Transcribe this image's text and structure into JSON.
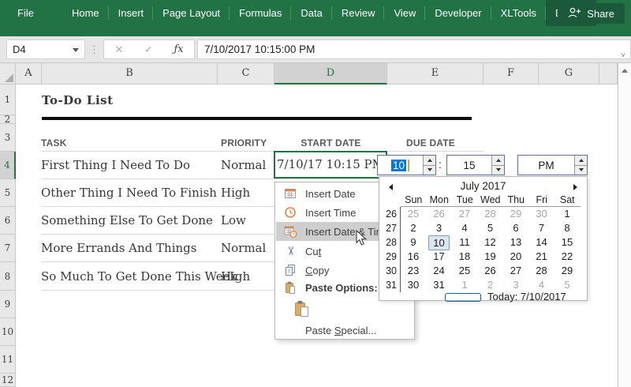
{
  "ribbon": {
    "tabs": [
      {
        "label": "File",
        "file_tab": true
      },
      {
        "label": "Home"
      },
      {
        "label": "Insert"
      },
      {
        "label": "Page Layout"
      },
      {
        "label": "Formulas"
      },
      {
        "label": "Data"
      },
      {
        "label": "Review"
      },
      {
        "label": "View"
      },
      {
        "label": "Developer"
      },
      {
        "label": "XLTools"
      },
      {
        "label": "Design",
        "active": true
      }
    ],
    "share_label": "Share",
    "colors": {
      "ribbon_green": "#217346",
      "active_tab_green": "#1a5a3a"
    }
  },
  "formula_bar": {
    "name_box_value": "D4",
    "cancel_glyph": "✕",
    "enter_glyph": "✓",
    "fx_label": "ƒx",
    "formula_value": "7/10/2017 10:15:00 PM"
  },
  "sheet": {
    "column_headers": [
      "A",
      "B",
      "C",
      "D",
      "E",
      "F",
      "G"
    ],
    "selected_column": "D",
    "row_headers": [
      "1",
      "2",
      "3",
      "4",
      "5",
      "6",
      "7",
      "8",
      "9",
      "10",
      "11",
      "12"
    ],
    "selected_row": "4",
    "title": "To-Do List",
    "table_headers": {
      "task": "TASK",
      "priority": "PRIORITY",
      "start_date": "START DATE",
      "due_date": "DUE DATE"
    },
    "tasks": [
      {
        "task": "First Thing I Need To Do",
        "priority": "Normal",
        "start_date": "7/10/17 10:15 PM",
        "selected": true
      },
      {
        "task": "Other Thing I Need To Finish",
        "priority": "High"
      },
      {
        "task": "Something Else To Get Done",
        "priority": "Low"
      },
      {
        "task": "More Errands And Things",
        "priority": "Normal"
      },
      {
        "task": "So Much To Get Done This Week",
        "priority": "High"
      }
    ]
  },
  "time_picker": {
    "hour": "10",
    "separator": ":",
    "minute": "15",
    "meridiem": "PM"
  },
  "context_menu": {
    "items": [
      {
        "id": "insert-date",
        "icon": "calendar-icon",
        "label": "Insert Date"
      },
      {
        "id": "insert-time",
        "icon": "clock-icon",
        "label": "Insert Time"
      },
      {
        "id": "insert-date-time",
        "icon": "calendar-clock-icon",
        "label": "Insert Date & Time",
        "highlighted": true
      },
      {
        "id": "cut",
        "icon": "scissors-icon",
        "label_pre": "Cu",
        "label_key": "t",
        "label_post": ""
      },
      {
        "id": "copy",
        "icon": "copy-icon",
        "label_pre": "",
        "label_key": "C",
        "label_post": "opy"
      },
      {
        "id": "paste-options",
        "icon": "clipboard-icon",
        "label": "Paste Options:",
        "bold": true
      },
      {
        "id": "paste-swatch",
        "icon": "paste-icon",
        "swatch": true
      },
      {
        "id": "paste-special",
        "label_pre": "Paste ",
        "label_key": "S",
        "label_post": "pecial..."
      }
    ]
  },
  "calendar": {
    "month_title": "July 2017",
    "day_names": [
      "Sun",
      "Mon",
      "Tue",
      "Wed",
      "Thu",
      "Fri",
      "Sat"
    ],
    "weeks": [
      {
        "num": "26",
        "days": [
          {
            "d": "25",
            "muted": true
          },
          {
            "d": "26",
            "muted": true
          },
          {
            "d": "27",
            "muted": true
          },
          {
            "d": "28",
            "muted": true
          },
          {
            "d": "29",
            "muted": true
          },
          {
            "d": "30",
            "muted": true
          },
          {
            "d": "1"
          }
        ]
      },
      {
        "num": "27",
        "days": [
          {
            "d": "2"
          },
          {
            "d": "3"
          },
          {
            "d": "4"
          },
          {
            "d": "5"
          },
          {
            "d": "6"
          },
          {
            "d": "7"
          },
          {
            "d": "8"
          }
        ]
      },
      {
        "num": "28",
        "days": [
          {
            "d": "9"
          },
          {
            "d": "10",
            "selected": true
          },
          {
            "d": "11"
          },
          {
            "d": "12"
          },
          {
            "d": "13"
          },
          {
            "d": "14"
          },
          {
            "d": "15"
          }
        ]
      },
      {
        "num": "29",
        "days": [
          {
            "d": "16"
          },
          {
            "d": "17"
          },
          {
            "d": "18"
          },
          {
            "d": "19"
          },
          {
            "d": "20"
          },
          {
            "d": "21"
          },
          {
            "d": "22"
          }
        ]
      },
      {
        "num": "30",
        "days": [
          {
            "d": "23"
          },
          {
            "d": "24"
          },
          {
            "d": "25"
          },
          {
            "d": "26"
          },
          {
            "d": "27"
          },
          {
            "d": "28"
          },
          {
            "d": "29"
          }
        ]
      },
      {
        "num": "31",
        "days": [
          {
            "d": "30"
          },
          {
            "d": "31"
          },
          {
            "d": "1",
            "muted": true
          },
          {
            "d": "2",
            "muted": true
          },
          {
            "d": "3",
            "muted": true
          },
          {
            "d": "4",
            "muted": true
          },
          {
            "d": "5",
            "muted": true
          }
        ]
      }
    ],
    "selected_day": "10",
    "today_label": "Today: 7/10/2017"
  }
}
